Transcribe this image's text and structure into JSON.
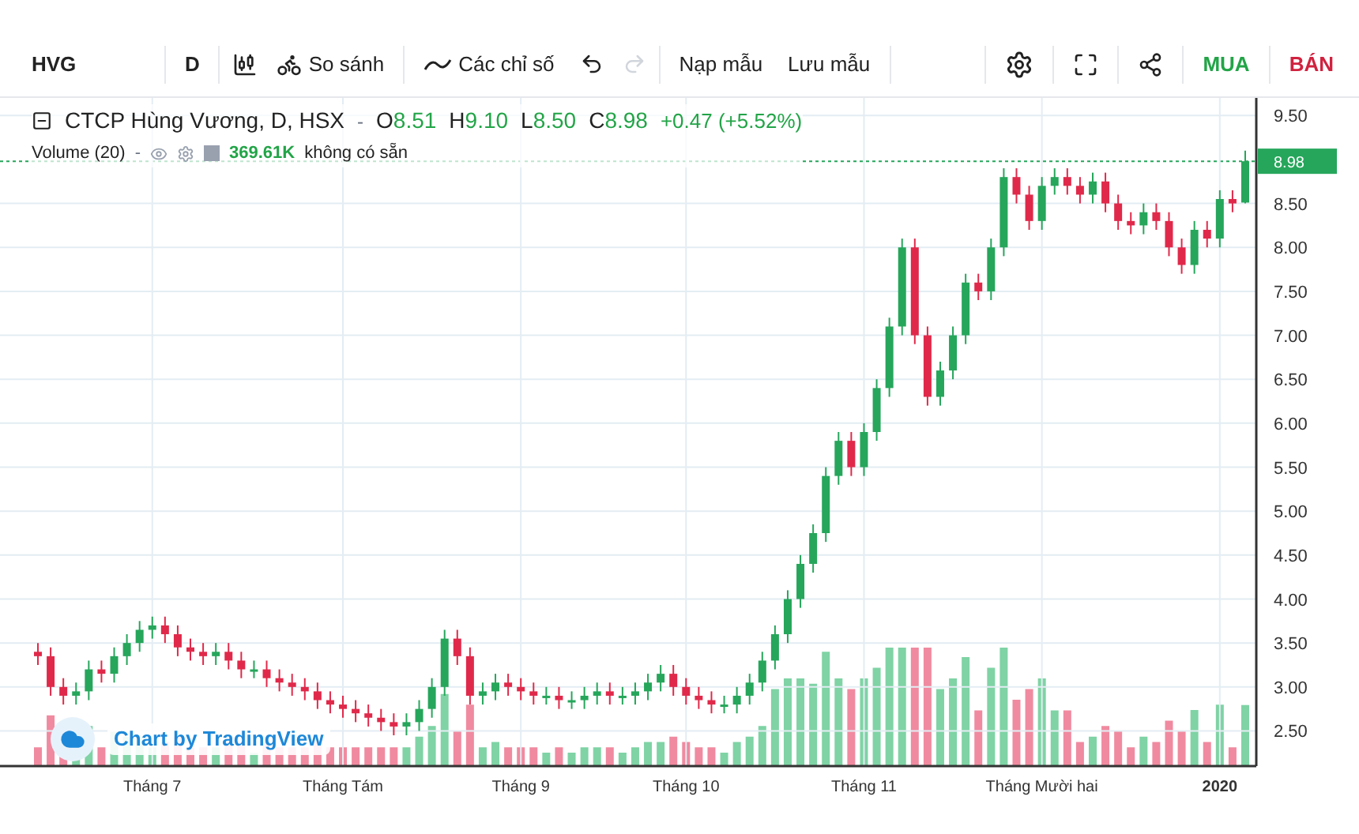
{
  "toolbar": {
    "symbol": "HVG",
    "interval": "D",
    "compare": "So sánh",
    "indicators": "Các chỉ số",
    "load_template": "Nạp mẫu",
    "save_template": "Lưu mẫu",
    "buy": "MUA",
    "sell": "BÁN"
  },
  "legend": {
    "title": "CTCP Hùng Vương, D, HSX",
    "caret": "-",
    "ohlc": [
      {
        "label": "O",
        "value": "8.51"
      },
      {
        "label": "H",
        "value": "9.10"
      },
      {
        "label": "L",
        "value": "8.50"
      },
      {
        "label": "C",
        "value": "8.98"
      }
    ],
    "change": "+0.47 (+5.52%)",
    "volume_title": "Volume (20)",
    "volume_caret": "-",
    "volume_value": "369.61K",
    "volume_note": "không có sẵn"
  },
  "logo": "Chart by TradingView",
  "price_label": "8.98",
  "chart_data": {
    "type": "candlestick",
    "categories": [
      null,
      null,
      null,
      null,
      null,
      null,
      null,
      null,
      null,
      "Tháng 7",
      null,
      null,
      null,
      null,
      null,
      null,
      null,
      null,
      null,
      null,
      null,
      null,
      null,
      null,
      "Tháng Tám",
      null,
      null,
      null,
      null,
      null,
      null,
      null,
      null,
      null,
      null,
      null,
      null,
      null,
      "Tháng 9",
      null,
      null,
      null,
      null,
      null,
      null,
      null,
      null,
      null,
      null,
      null,
      null,
      "Tháng 10",
      null,
      null,
      null,
      null,
      null,
      null,
      null,
      null,
      null,
      null,
      null,
      null,
      null,
      "Tháng 11",
      null,
      null,
      null,
      null,
      null,
      null,
      null,
      null,
      null,
      null,
      null,
      null,
      null,
      "Tháng Mười hai",
      null,
      null,
      null,
      null,
      null,
      null,
      null,
      null,
      null,
      null,
      null,
      null,
      null,
      "2020",
      null,
      null
    ],
    "ohlc": [
      [
        3.4,
        3.5,
        3.25,
        3.35
      ],
      [
        3.35,
        3.45,
        2.9,
        3.0
      ],
      [
        3.0,
        3.1,
        2.8,
        2.9
      ],
      [
        2.9,
        3.05,
        2.8,
        2.95
      ],
      [
        2.95,
        3.3,
        2.85,
        3.2
      ],
      [
        3.2,
        3.3,
        3.05,
        3.15
      ],
      [
        3.15,
        3.45,
        3.05,
        3.35
      ],
      [
        3.35,
        3.6,
        3.25,
        3.5
      ],
      [
        3.5,
        3.75,
        3.4,
        3.65
      ],
      [
        3.65,
        3.8,
        3.55,
        3.7
      ],
      [
        3.7,
        3.8,
        3.5,
        3.6
      ],
      [
        3.6,
        3.7,
        3.35,
        3.45
      ],
      [
        3.45,
        3.55,
        3.3,
        3.4
      ],
      [
        3.4,
        3.5,
        3.25,
        3.35
      ],
      [
        3.35,
        3.5,
        3.25,
        3.4
      ],
      [
        3.4,
        3.5,
        3.2,
        3.3
      ],
      [
        3.3,
        3.4,
        3.1,
        3.2
      ],
      [
        3.2,
        3.3,
        3.1,
        3.2
      ],
      [
        3.2,
        3.3,
        3.0,
        3.1
      ],
      [
        3.1,
        3.2,
        2.95,
        3.05
      ],
      [
        3.05,
        3.15,
        2.9,
        3.0
      ],
      [
        3.0,
        3.1,
        2.85,
        2.95
      ],
      [
        2.95,
        3.05,
        2.75,
        2.85
      ],
      [
        2.85,
        2.95,
        2.7,
        2.8
      ],
      [
        2.8,
        2.9,
        2.65,
        2.75
      ],
      [
        2.75,
        2.85,
        2.6,
        2.7
      ],
      [
        2.7,
        2.8,
        2.55,
        2.65
      ],
      [
        2.65,
        2.75,
        2.5,
        2.6
      ],
      [
        2.6,
        2.7,
        2.45,
        2.55
      ],
      [
        2.55,
        2.7,
        2.45,
        2.6
      ],
      [
        2.6,
        2.85,
        2.5,
        2.75
      ],
      [
        2.75,
        3.1,
        2.65,
        3.0
      ],
      [
        3.0,
        3.65,
        2.9,
        3.55
      ],
      [
        3.55,
        3.65,
        3.25,
        3.35
      ],
      [
        3.35,
        3.45,
        2.8,
        2.9
      ],
      [
        2.9,
        3.05,
        2.8,
        2.95
      ],
      [
        2.95,
        3.15,
        2.85,
        3.05
      ],
      [
        3.05,
        3.15,
        2.9,
        3.0
      ],
      [
        3.0,
        3.1,
        2.85,
        2.95
      ],
      [
        2.95,
        3.05,
        2.8,
        2.9
      ],
      [
        2.9,
        3.0,
        2.8,
        2.9
      ],
      [
        2.9,
        3.0,
        2.75,
        2.85
      ],
      [
        2.85,
        2.95,
        2.75,
        2.85
      ],
      [
        2.85,
        3.0,
        2.75,
        2.9
      ],
      [
        2.9,
        3.05,
        2.8,
        2.95
      ],
      [
        2.95,
        3.05,
        2.8,
        2.9
      ],
      [
        2.9,
        3.0,
        2.8,
        2.9
      ],
      [
        2.9,
        3.05,
        2.8,
        2.95
      ],
      [
        2.95,
        3.15,
        2.85,
        3.05
      ],
      [
        3.05,
        3.25,
        2.95,
        3.15
      ],
      [
        3.15,
        3.25,
        2.9,
        3.0
      ],
      [
        3.0,
        3.1,
        2.8,
        2.9
      ],
      [
        2.9,
        3.0,
        2.75,
        2.85
      ],
      [
        2.85,
        2.95,
        2.7,
        2.8
      ],
      [
        2.8,
        2.9,
        2.7,
        2.8
      ],
      [
        2.8,
        3.0,
        2.7,
        2.9
      ],
      [
        2.9,
        3.15,
        2.8,
        3.05
      ],
      [
        3.05,
        3.4,
        2.95,
        3.3
      ],
      [
        3.3,
        3.7,
        3.2,
        3.6
      ],
      [
        3.6,
        4.1,
        3.5,
        4.0
      ],
      [
        4.0,
        4.5,
        3.9,
        4.4
      ],
      [
        4.4,
        4.85,
        4.3,
        4.75
      ],
      [
        4.75,
        5.5,
        4.65,
        5.4
      ],
      [
        5.4,
        5.9,
        5.3,
        5.8
      ],
      [
        5.8,
        5.9,
        5.4,
        5.5
      ],
      [
        5.5,
        6.0,
        5.4,
        5.9
      ],
      [
        5.9,
        6.5,
        5.8,
        6.4
      ],
      [
        6.4,
        7.2,
        6.3,
        7.1
      ],
      [
        7.1,
        8.1,
        7.0,
        8.0
      ],
      [
        8.0,
        8.1,
        6.9,
        7.0
      ],
      [
        7.0,
        7.1,
        6.2,
        6.3
      ],
      [
        6.3,
        6.7,
        6.2,
        6.6
      ],
      [
        6.6,
        7.1,
        6.5,
        7.0
      ],
      [
        7.0,
        7.7,
        6.9,
        7.6
      ],
      [
        7.6,
        7.7,
        7.4,
        7.5
      ],
      [
        7.5,
        8.1,
        7.4,
        8.0
      ],
      [
        8.0,
        8.9,
        7.9,
        8.8
      ],
      [
        8.8,
        8.9,
        8.5,
        8.6
      ],
      [
        8.6,
        8.7,
        8.2,
        8.3
      ],
      [
        8.3,
        8.8,
        8.2,
        8.7
      ],
      [
        8.7,
        8.9,
        8.6,
        8.8
      ],
      [
        8.8,
        8.9,
        8.6,
        8.7
      ],
      [
        8.7,
        8.8,
        8.5,
        8.6
      ],
      [
        8.6,
        8.85,
        8.5,
        8.75
      ],
      [
        8.75,
        8.85,
        8.4,
        8.5
      ],
      [
        8.5,
        8.6,
        8.2,
        8.3
      ],
      [
        8.3,
        8.4,
        8.15,
        8.25
      ],
      [
        8.25,
        8.5,
        8.15,
        8.4
      ],
      [
        8.4,
        8.5,
        8.2,
        8.3
      ],
      [
        8.3,
        8.4,
        7.9,
        8.0
      ],
      [
        8.0,
        8.1,
        7.7,
        7.8
      ],
      [
        7.8,
        8.3,
        7.7,
        8.2
      ],
      [
        8.2,
        8.3,
        8.0,
        8.1
      ],
      [
        8.1,
        8.65,
        8.0,
        8.55
      ],
      [
        8.55,
        8.65,
        8.4,
        8.5
      ],
      [
        8.51,
        9.1,
        8.5,
        8.98
      ]
    ],
    "ylim": [
      2.1,
      9.7
    ],
    "yticks": [
      {
        "value": 9.5,
        "label": "9.50"
      },
      {
        "value": 8.5,
        "label": "8.50"
      },
      {
        "value": 8,
        "label": "8.00"
      },
      {
        "value": 7.5,
        "label": "7.50"
      },
      {
        "value": 7,
        "label": "7.00"
      },
      {
        "value": 6.5,
        "label": "6.50"
      },
      {
        "value": 6,
        "label": "6.00"
      },
      {
        "value": 5.5,
        "label": "5.50"
      },
      {
        "value": 5,
        "label": "5.00"
      },
      {
        "value": 4.5,
        "label": "4.50"
      },
      {
        "value": 4,
        "label": "4.00"
      },
      {
        "value": 3.5,
        "label": "3.50"
      },
      {
        "value": 3,
        "label": "3.00"
      },
      {
        "value": 2.5,
        "label": "2.50"
      }
    ],
    "grid": true
  }
}
